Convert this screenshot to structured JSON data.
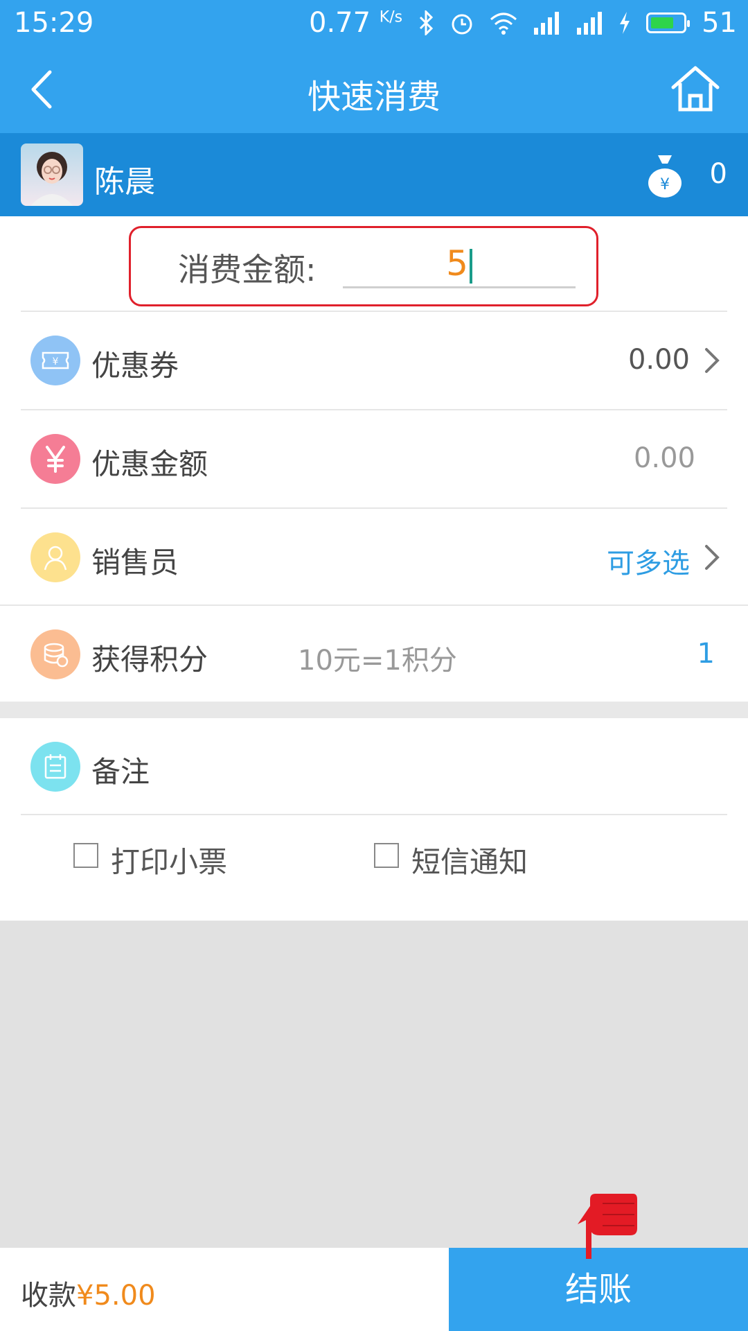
{
  "status_bar": {
    "time": "15:29",
    "speed": "0.77",
    "speed_unit": "K/s",
    "battery": "51"
  },
  "nav": {
    "title": "快速消费"
  },
  "member": {
    "name": "陈晨",
    "points": "0"
  },
  "amount": {
    "label": "消费金额:",
    "value": "5"
  },
  "rows": {
    "coupon": {
      "label": "优惠券",
      "value": "0.00",
      "icon": "coupon-icon",
      "color": "#8fc3f5"
    },
    "discount": {
      "label": "优惠金额",
      "value": "0.00",
      "icon": "yen-icon",
      "color": "#f57d95"
    },
    "salesperson": {
      "label": "销售员",
      "value": "可多选",
      "icon": "person-icon",
      "color": "#fde18e"
    },
    "points": {
      "label": "获得积分",
      "rule": "10元=1积分",
      "value": "1",
      "icon": "coins-icon",
      "color": "#fbbd92"
    },
    "remark": {
      "label": "备注",
      "icon": "notepad-icon",
      "color": "#7ce2ef"
    }
  },
  "options": {
    "print_receipt": "打印小票",
    "sms_notify": "短信通知"
  },
  "footer": {
    "collect_label": "收款",
    "collect_amount": "¥5.00",
    "checkout": "结账"
  },
  "colors": {
    "primary": "#33a3ee",
    "member_bar": "#1b8ad8",
    "accent_orange": "#f08a1c",
    "highlight_red": "#e0202b"
  }
}
